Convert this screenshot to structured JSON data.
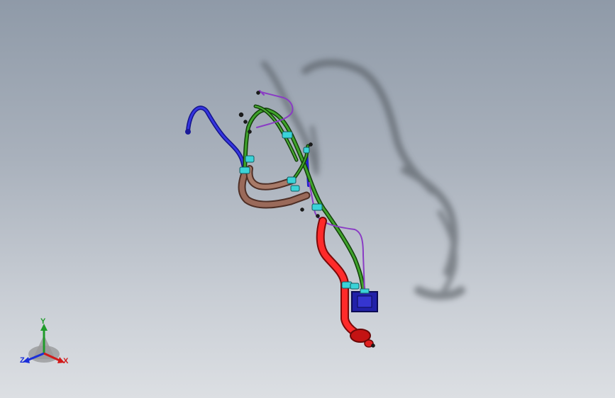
{
  "viewport": {
    "background_top": "#8f9aa8",
    "background_bottom": "#dcdfe3"
  },
  "assembly": {
    "pipe_colors": {
      "blue": "#2222cc",
      "green": "#2f8a1e",
      "copper": "#8a5a4a",
      "red": "#e01515",
      "purple": "#8a3cc4",
      "clamp": "#3ad3d8",
      "shadow": "#4a4f55"
    }
  },
  "triad": {
    "y_label": "Y",
    "z_label": "Z",
    "x_label": "X",
    "y_color": "#1f9b2a",
    "z_color": "#1b2fd9",
    "x_color": "#d11a1a"
  }
}
